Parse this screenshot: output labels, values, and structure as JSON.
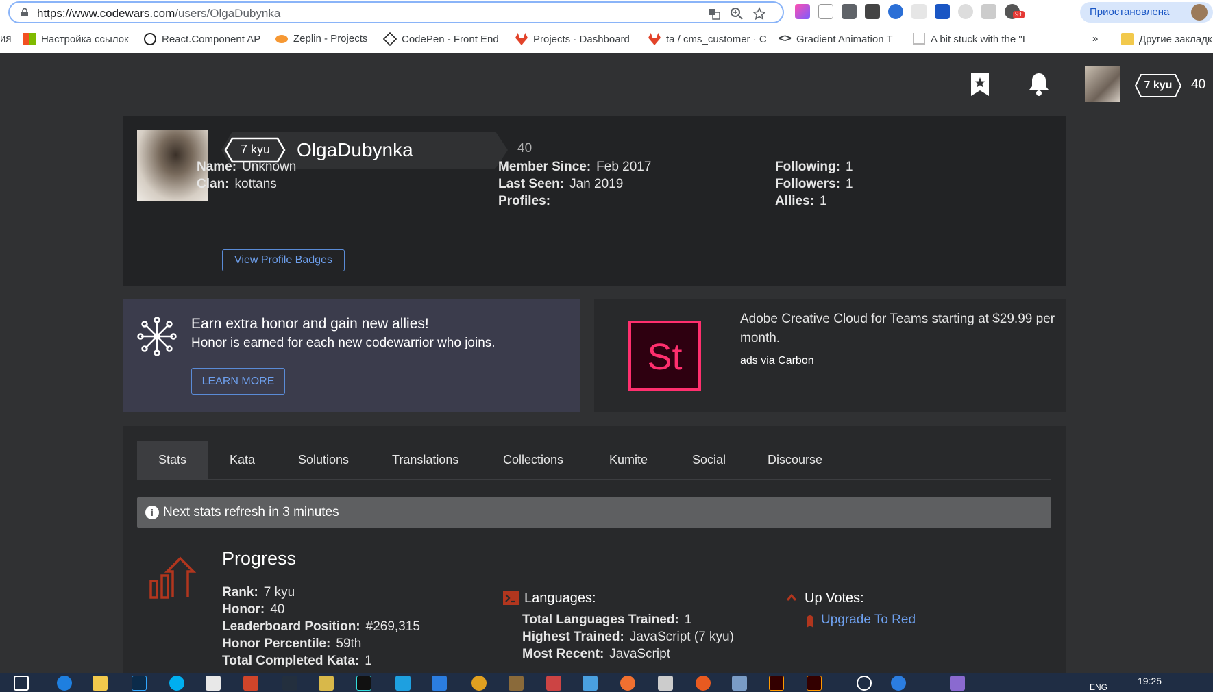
{
  "browser": {
    "url_host": "https://www.codewars.com",
    "url_path": "/users/OlgaDubynka",
    "profile_button": "Приостановлена",
    "ext_badge": "9+",
    "bookmarks": [
      {
        "label": "ия"
      },
      {
        "label": "Настройка ссылок"
      },
      {
        "label": "React.Component AP"
      },
      {
        "label": "Zeplin - Projects"
      },
      {
        "label": "CodePen - Front End"
      },
      {
        "label": "Projects · Dashboard"
      },
      {
        "label": "ta / cms_customer · C"
      },
      {
        "label": "Gradient Animation T"
      },
      {
        "label": "A bit stuck with the \"I"
      }
    ],
    "more_bookmarks": "»",
    "other_bookmarks": "Другие закладк"
  },
  "header": {
    "rank": "7 kyu",
    "honor": "40"
  },
  "profile": {
    "rank": "7 kyu",
    "username": "OlgaDubynka",
    "honor": "40",
    "col1": [
      {
        "label": "Name:",
        "value": "Unknown"
      },
      {
        "label": "Clan:",
        "value": "kottans"
      }
    ],
    "col2": [
      {
        "label": "Member Since:",
        "value": "Feb 2017"
      },
      {
        "label": "Last Seen:",
        "value": "Jan 2019"
      },
      {
        "label": "Profiles:",
        "value": ""
      }
    ],
    "col3": [
      {
        "label": "Following:",
        "value": "1"
      },
      {
        "label": "Followers:",
        "value": "1"
      },
      {
        "label": "Allies:",
        "value": "1"
      }
    ],
    "badges_button": "View Profile Badges"
  },
  "promo": {
    "title": "Earn extra honor and gain new allies!",
    "subtitle": "Honor is earned for each new codewarrior who joins.",
    "button": "LEARN MORE"
  },
  "ad": {
    "logo_text": "St",
    "text": "Adobe Creative Cloud for Teams starting at $29.99 per month.",
    "via": "ads via Carbon"
  },
  "tabs": [
    {
      "label": "Stats"
    },
    {
      "label": "Kata"
    },
    {
      "label": "Solutions"
    },
    {
      "label": "Translations"
    },
    {
      "label": "Collections"
    },
    {
      "label": "Kumite"
    },
    {
      "label": "Social"
    },
    {
      "label": "Discourse"
    }
  ],
  "notice": "Next stats refresh in 3 minutes",
  "progress": {
    "title": "Progress",
    "rows": [
      {
        "label": "Rank:",
        "value": "7 kyu"
      },
      {
        "label": "Honor:",
        "value": "40"
      },
      {
        "label": "Leaderboard Position:",
        "value": "#269,315"
      },
      {
        "label": "Honor Percentile:",
        "value": "59th"
      },
      {
        "label": "Total Completed Kata:",
        "value": "1"
      }
    ]
  },
  "languages": {
    "title": "Languages:",
    "rows": [
      {
        "label": "Total Languages Trained:",
        "value": "1"
      },
      {
        "label": "Highest Trained:",
        "value": "JavaScript (7 kyu)"
      },
      {
        "label": "Most Recent:",
        "value": "JavaScript"
      }
    ]
  },
  "upvotes": {
    "title": "Up Votes:",
    "link": "Upgrade To Red"
  },
  "taskbar": {
    "lang": "ENG",
    "time": "19:25"
  },
  "colors": {
    "page_bg": "#303133",
    "card_bg": "#222325",
    "promo_bg": "#3b3c4c",
    "accent_link": "#6ea0ee",
    "danger_red": "#b1361e",
    "adobe_pink": "#ff2f6e"
  }
}
